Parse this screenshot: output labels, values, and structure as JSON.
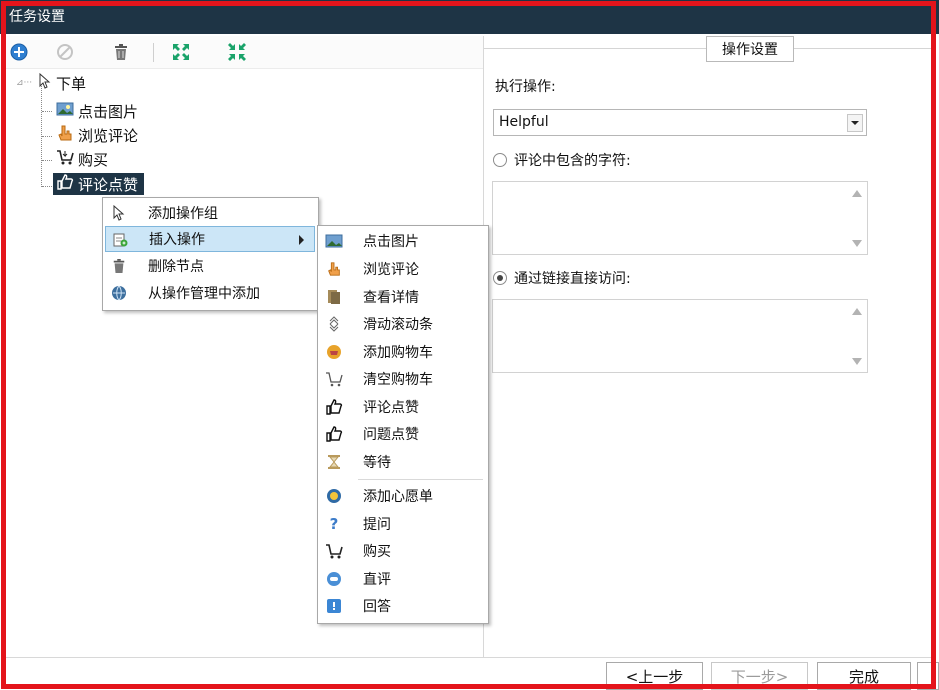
{
  "window": {
    "title": "任务设置"
  },
  "toolbar": {
    "icons": [
      "add-icon",
      "disable-icon",
      "trash-icon",
      "expand-icon",
      "collapse-icon"
    ]
  },
  "tree": {
    "root": {
      "label": "下单",
      "icon": "cursor-icon"
    },
    "children": [
      {
        "label": "点击图片",
        "icon": "image-icon"
      },
      {
        "label": "浏览评论",
        "icon": "hand-pointer-icon"
      },
      {
        "label": "购买",
        "icon": "cart-icon"
      },
      {
        "label": "评论点赞",
        "icon": "thumbs-up-icon",
        "selected": true
      }
    ]
  },
  "context_menu": {
    "items": [
      {
        "label": "添加操作组",
        "icon": "cursor-icon"
      },
      {
        "label": "插入操作",
        "icon": "insert-icon",
        "highlighted": true,
        "has_submenu": true
      },
      {
        "label": "删除节点",
        "icon": "trash-icon"
      },
      {
        "label": "从操作管理中添加",
        "icon": "globe-icon"
      }
    ]
  },
  "submenu": {
    "items": [
      {
        "label": "点击图片",
        "icon": "image-icon"
      },
      {
        "label": "浏览评论",
        "icon": "hand-pointer-icon"
      },
      {
        "label": "查看详情",
        "icon": "document-icon"
      },
      {
        "label": "滑动滚动条",
        "icon": "scroll-icon"
      },
      {
        "label": "添加购物车",
        "icon": "basket-icon"
      },
      {
        "label": "清空购物车",
        "icon": "empty-cart-icon"
      },
      {
        "label": "评论点赞",
        "icon": "thumbs-up-icon"
      },
      {
        "label": "问题点赞",
        "icon": "thumbs-up-icon"
      },
      {
        "label": "等待",
        "icon": "hourglass-icon"
      },
      {
        "label": "添加心愿单",
        "icon": "wishlist-icon"
      },
      {
        "label": "提问",
        "icon": "question-icon"
      },
      {
        "label": "购买",
        "icon": "cart-icon"
      },
      {
        "label": "直评",
        "icon": "comment-icon"
      },
      {
        "label": "回答",
        "icon": "answer-icon"
      }
    ]
  },
  "settings": {
    "group_title": "操作设置",
    "action_label": "执行操作:",
    "action_value": "Helpful",
    "option_contains_label": "评论中包含的字符:",
    "option_contains_checked": false,
    "option_link_label": "通过链接直接访问:",
    "option_link_checked": true
  },
  "footer": {
    "prev_label": "<上一步",
    "next_label": "下一步>",
    "finish_label": "完成"
  },
  "colors": {
    "titlebar": "#1e3445",
    "frame": "#e4141b",
    "menu_highlight": "#cce6f7",
    "selection": "#1e3445"
  }
}
